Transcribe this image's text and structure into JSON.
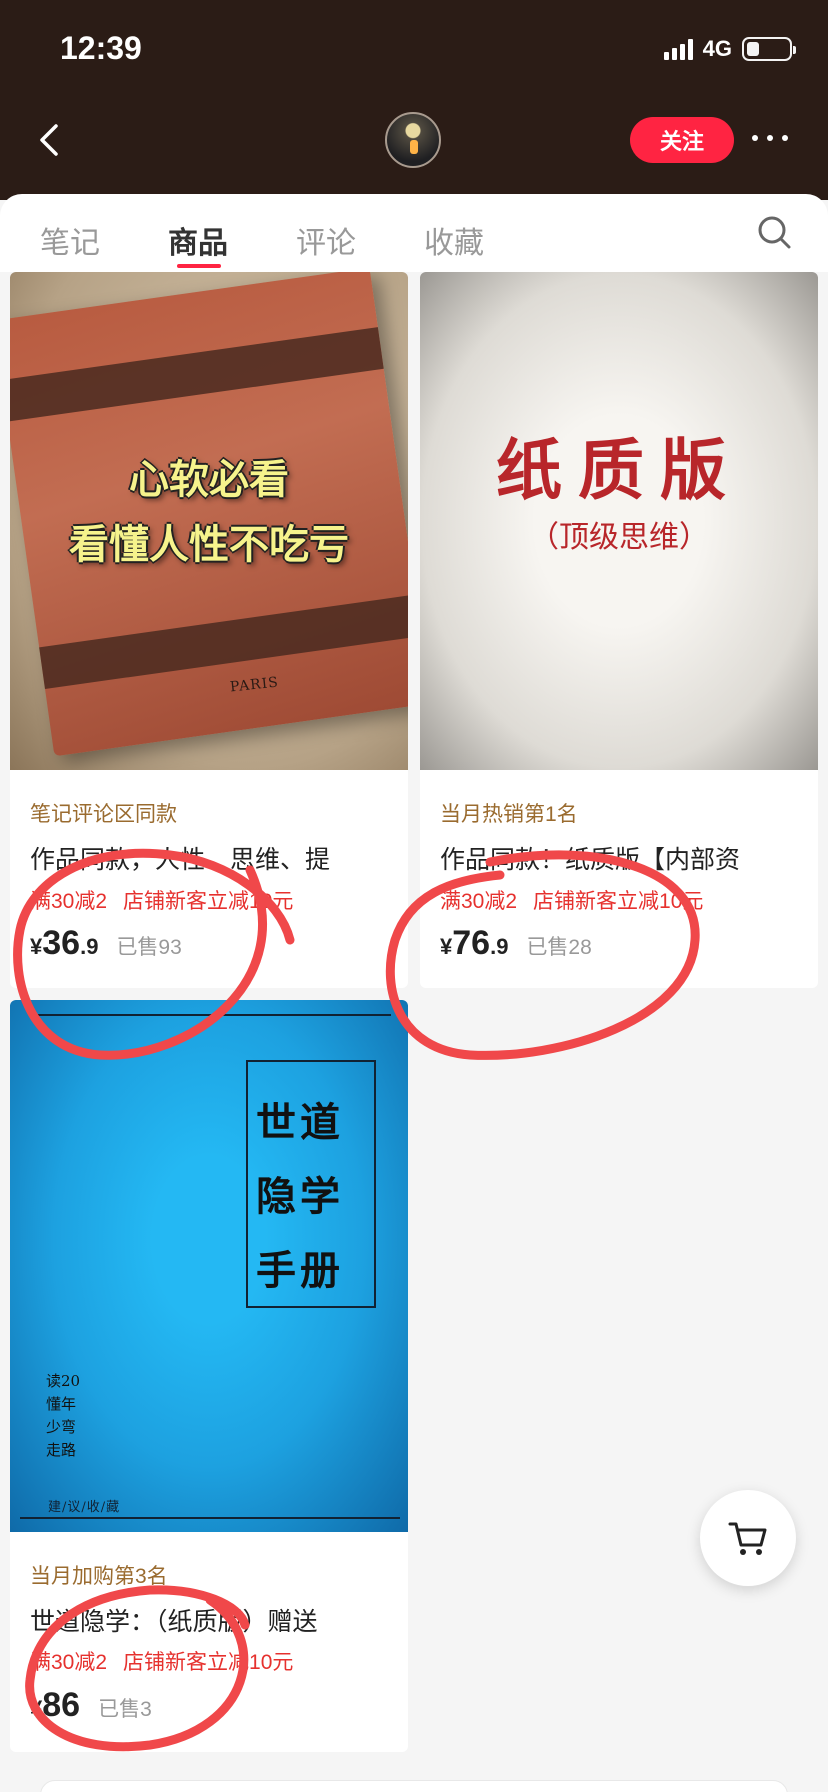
{
  "status_bar": {
    "time": "12:39",
    "network": "4G"
  },
  "header": {
    "follow_label": "关注"
  },
  "tabs": [
    {
      "label": "笔记",
      "active": false
    },
    {
      "label": "商品",
      "active": true
    },
    {
      "label": "评论",
      "active": false
    },
    {
      "label": "收藏",
      "active": false
    }
  ],
  "products": [
    {
      "cover_line1": "心软必看",
      "cover_line2": "看懂人性不吃亏",
      "cover_imprint": "PARIS",
      "rank": "笔记评论区同款",
      "title": "作品同款，人性、思维、提",
      "promo1": "满30减2",
      "promo2": "店铺新客立减10元",
      "yen": "¥",
      "price_int": "36",
      "price_dec": ".9",
      "sold": "已售93"
    },
    {
      "cover_big": "纸质版",
      "cover_small": "（顶级思维）",
      "rank": "当月热销第1名",
      "title": "作品同款！纸质版【内部资",
      "promo1": "满30减2",
      "promo2": "店铺新客立减10元",
      "yen": "¥",
      "price_int": "76",
      "price_dec": ".9",
      "sold": "已售28"
    },
    {
      "cover_title": "世道隐学手册",
      "cover_side": "读20懂年少弯走路",
      "cover_foot": "建/议/收/藏",
      "rank": "当月加购第3名",
      "title": "世道隐学：（纸质版）赠送",
      "promo1": "满30减2",
      "promo2": "店铺新客立减10元",
      "yen": "¥",
      "price_int": "86",
      "price_dec": "",
      "sold": "已售3"
    }
  ],
  "colors": {
    "brand_red": "#ff2442",
    "header_bg": "#2b1c16",
    "promo_red": "#e6312e",
    "rank_gold": "#9a6b2f",
    "annotation_red": "#f0484a"
  },
  "icons": [
    "back-chevron-icon",
    "more-dots-icon",
    "search-icon",
    "cart-icon",
    "signal-icon",
    "battery-icon"
  ]
}
